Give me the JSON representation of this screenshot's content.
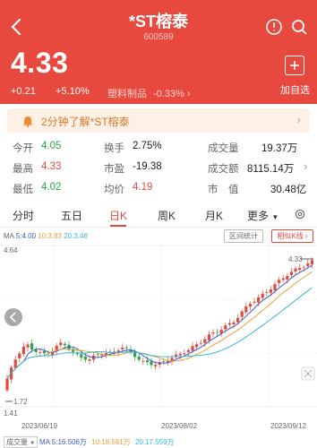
{
  "header": {
    "title": "*ST榕泰",
    "code": "600589",
    "price": "4.33",
    "change": "+0.21",
    "change_pct": "+5.10%",
    "sector": "塑料制品",
    "sector_pct": "-0.33%",
    "add_label": "加自选"
  },
  "promo": {
    "text": "2分钟了解*ST榕泰"
  },
  "stats": [
    {
      "label": "今开",
      "value": "4.05"
    },
    {
      "label": "换手",
      "value": "2.75%"
    },
    {
      "label": "成交量",
      "value": "19.37万"
    },
    {
      "label": "最高",
      "value": "4.33"
    },
    {
      "label": "市盈",
      "value": "-19.38"
    },
    {
      "label": "成交额",
      "value": "8115.14万"
    },
    {
      "label": "最低",
      "value": "4.02"
    },
    {
      "label": "均价",
      "value": "4.19"
    },
    {
      "label": "市　值",
      "value": "30.48亿"
    }
  ],
  "tabs": [
    "分时",
    "五日",
    "日K",
    "周K",
    "月K",
    "更多"
  ],
  "chart_header": {
    "ma_label": "MA",
    "ma5": "5:4.00",
    "ma10": "10:3.83",
    "ma20": "20:3.46",
    "range_stats": "区间统计",
    "similar_k": "相似K线"
  },
  "chart_data": {
    "type": "candlestick",
    "y_max_label": "4.64",
    "y_min_label": "1.41",
    "high_marker": "4.33",
    "low_marker": "1.72",
    "x_labels": [
      "2023/06/19",
      "2023/08/02",
      "2023/09/12"
    ],
    "ylim": [
      1.41,
      4.64
    ]
  },
  "volume": {
    "selector": "成交量",
    "ma5": "MA 5:16.506万",
    "ma10": "10:18.581万",
    "ma20": "20:17.559万"
  },
  "colors": {
    "brand": "#E8493F",
    "up": "#E04B3F",
    "down": "#2FA24D"
  }
}
